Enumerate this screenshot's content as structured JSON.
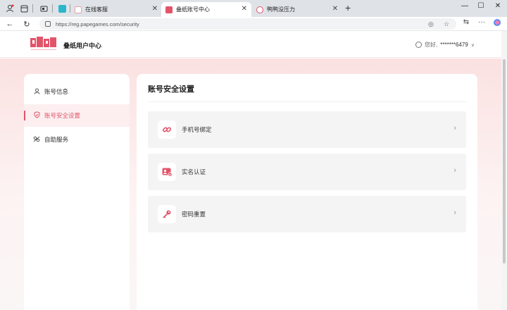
{
  "browser": {
    "tabs": [
      {
        "label": "在线客服",
        "active": false
      },
      {
        "label": "叠纸账号中心",
        "active": true
      },
      {
        "label": "鸭鸭没压力",
        "active": false
      }
    ],
    "url": "https://reg.papegames.com/security"
  },
  "header": {
    "brand": "叠纸用户中心",
    "greeting": "您好,",
    "username": "*******6479"
  },
  "sidebar": {
    "items": [
      {
        "label": "账号信息",
        "icon": "user-icon"
      },
      {
        "label": "账号安全设置",
        "icon": "shield-icon",
        "active": true
      },
      {
        "label": "自助服务",
        "icon": "self-service-icon"
      }
    ]
  },
  "main": {
    "title": "账号安全设置",
    "rows": [
      {
        "label": "手机号绑定",
        "icon": "link-icon"
      },
      {
        "label": "实名认证",
        "icon": "id-card-icon"
      },
      {
        "label": "密码重置",
        "icon": "key-icon"
      }
    ]
  },
  "colors": {
    "accent": "#e2546a",
    "background_pink": "#fbe1e1"
  }
}
